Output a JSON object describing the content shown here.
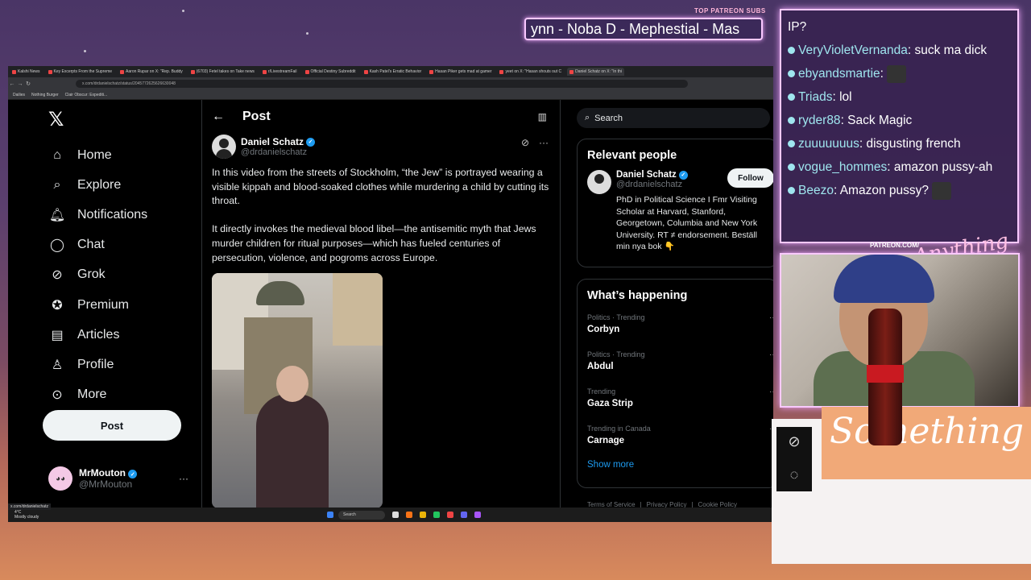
{
  "overlay": {
    "patreon_label": "TOP PATREON SUBS",
    "ticker": "ynn -  Noba D - Mephestial - Mas",
    "patreon_url": "PATREON.COM/",
    "signature": "Anything else",
    "script_word": "Something"
  },
  "chat": [
    {
      "user": "",
      "text": "IP?",
      "dot": false
    },
    {
      "user": "VeryVioletVernanda",
      "text": ": suck ma dick",
      "dot": true
    },
    {
      "user": "ebyandsmartie",
      "text": ":",
      "dot": true,
      "emote": true
    },
    {
      "user": "Triads",
      "text": ": lol",
      "dot": true
    },
    {
      "user": "ryder88",
      "text": ": Sack Magic",
      "dot": true
    },
    {
      "user": "zuuuuuuus",
      "text": ": disgusting french",
      "dot": true
    },
    {
      "user": "vogue_hommes",
      "text": ": amazon pussy-ah",
      "dot": true
    },
    {
      "user": "Beezo",
      "text": ": Amazon pussy?",
      "dot": true,
      "emote": true
    }
  ],
  "browser": {
    "tabs": [
      {
        "label": "Kalshi News",
        "active": false
      },
      {
        "label": "Key Excerpts From the Supreme",
        "active": false
      },
      {
        "label": "Aaron Rupar on X: \"Rep. Buddy",
        "active": false
      },
      {
        "label": "(6703) Fetel takes on Take news",
        "active": false
      },
      {
        "label": "r/LivestreamFail",
        "active": false
      },
      {
        "label": "Official Destiny Subreddit",
        "active": false
      },
      {
        "label": "Kash Patel's Erratic Behavior",
        "active": false
      },
      {
        "label": "Hasan Piker gets mad at gamer",
        "active": false
      },
      {
        "label": "yeet on X: \"Hasan shouts out C",
        "active": false
      },
      {
        "label": "Daniel Schatz on X: \"In thi",
        "active": true
      }
    ],
    "url": "x.com/drdanielschatz/status/2045772625626630048",
    "bookmarks": [
      "Dailies",
      "Nothing Burger",
      "Clair Obscur: Expediti..."
    ],
    "status_url": "x.com/drdanielschatz",
    "weather_temp": "4°C",
    "weather_desc": "Mostly cloudy",
    "taskbar_search": "Search"
  },
  "nav": {
    "items": [
      {
        "label": "Home",
        "icon": "home-icon"
      },
      {
        "label": "Explore",
        "icon": "search-icon"
      },
      {
        "label": "Notifications",
        "icon": "bell-icon"
      },
      {
        "label": "Chat",
        "icon": "chat-icon"
      },
      {
        "label": "Grok",
        "icon": "grok-icon"
      },
      {
        "label": "Premium",
        "icon": "premium-icon"
      },
      {
        "label": "Articles",
        "icon": "articles-icon"
      },
      {
        "label": "Profile",
        "icon": "person-icon"
      },
      {
        "label": "More",
        "icon": "more-icon"
      }
    ],
    "post_label": "Post",
    "me_name": "MrMouton",
    "me_handle": "@MrMouton"
  },
  "post": {
    "header": "Post",
    "author_name": "Daniel Schatz",
    "author_handle": "@drdanielschatz",
    "paragraph1": "In this video from the streets of Stockholm, “the Jew” is portrayed wearing a visible kippah and blood-soaked clothes while  murdering a child by cutting its throat.",
    "paragraph2": "It directly invokes the medieval blood libel—the antisemitic myth that Jews murder children for ritual purposes—which has fueled centuries of persecution, violence, and pogroms across Europe."
  },
  "sidebar": {
    "search_placeholder": "Search",
    "relevant_title": "Relevant people",
    "person_name": "Daniel Schatz",
    "person_handle": "@drdanielschatz",
    "follow_label": "Follow",
    "person_bio": "PhD in Political Science I Fmr Visiting Scholar at Harvard, Stanford, Georgetown, Columbia and New York University. RT ≠ endorsement. Beställ min nya bok 👇",
    "happening_title": "What’s happening",
    "trends": [
      {
        "category": "Politics · Trending",
        "title": "Corbyn"
      },
      {
        "category": "Politics · Trending",
        "title": "Abdul"
      },
      {
        "category": "Trending",
        "title": "Gaza Strip"
      },
      {
        "category": "Trending in Canada",
        "title": "Carnage"
      }
    ],
    "show_more": "Show more",
    "footer": [
      "Terms of Service",
      "Privacy Policy",
      "Cookie Policy"
    ]
  },
  "colors": {
    "accent": "#1d9bf0",
    "overlay_border": "#f9c9ff",
    "chat_user": "#9fe6ef"
  }
}
